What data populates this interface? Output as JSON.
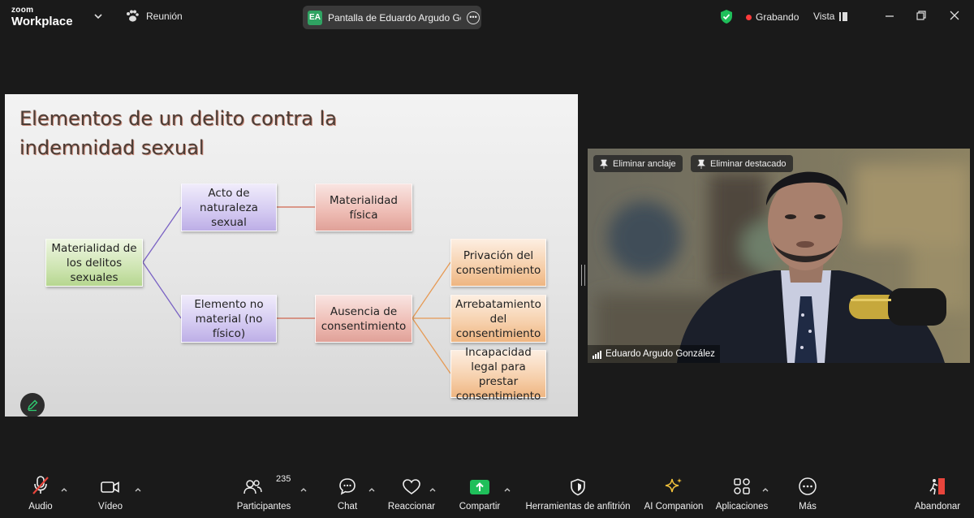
{
  "app": {
    "brand_small": "zoom",
    "brand_large": "Workplace",
    "meeting_label": "Reunión",
    "share_initials": "EA",
    "share_label": "Pantalla de Eduardo Argudo Gor",
    "recording_label": "Grabando",
    "view_label": "Vista"
  },
  "slide": {
    "title_line1": "Elementos de un delito contra la",
    "title_line2": "indemnidad sexual",
    "nodes": {
      "root": "Materialidad de los delitos sexuales",
      "acto": "Acto de naturaleza sexual",
      "materialidad_fisica": "Materialidad física",
      "elemento": "Elemento no material (no físico)",
      "ausencia": "Ausencia de consentimiento",
      "privacion": "Privación del consentimiento",
      "arrebatamiento": "Arrebatamiento del consentimiento",
      "incapacidad": "Incapacidad legal para prestar consentimiento"
    }
  },
  "video": {
    "unpin_label": "Eliminar anclaje",
    "unspotlight_label": "Eliminar destacado",
    "participant_name": "Eduardo Argudo González"
  },
  "toolbar": {
    "audio": "Audio",
    "video": "Vídeo",
    "participants": "Participantes",
    "participants_count": "235",
    "chat": "Chat",
    "react": "Reaccionar",
    "share": "Compartir",
    "host_tools": "Herramientas de anfitrión",
    "ai_companion": "AI Companion",
    "apps": "Aplicaciones",
    "more": "Más",
    "leave": "Abandonar"
  },
  "colors": {
    "background": "#1a1a1a",
    "share_green": "#1fbf5a",
    "recording_red": "#ff3b3b",
    "muted_red": "#e8453c",
    "shield_green": "#1fbf5a"
  }
}
